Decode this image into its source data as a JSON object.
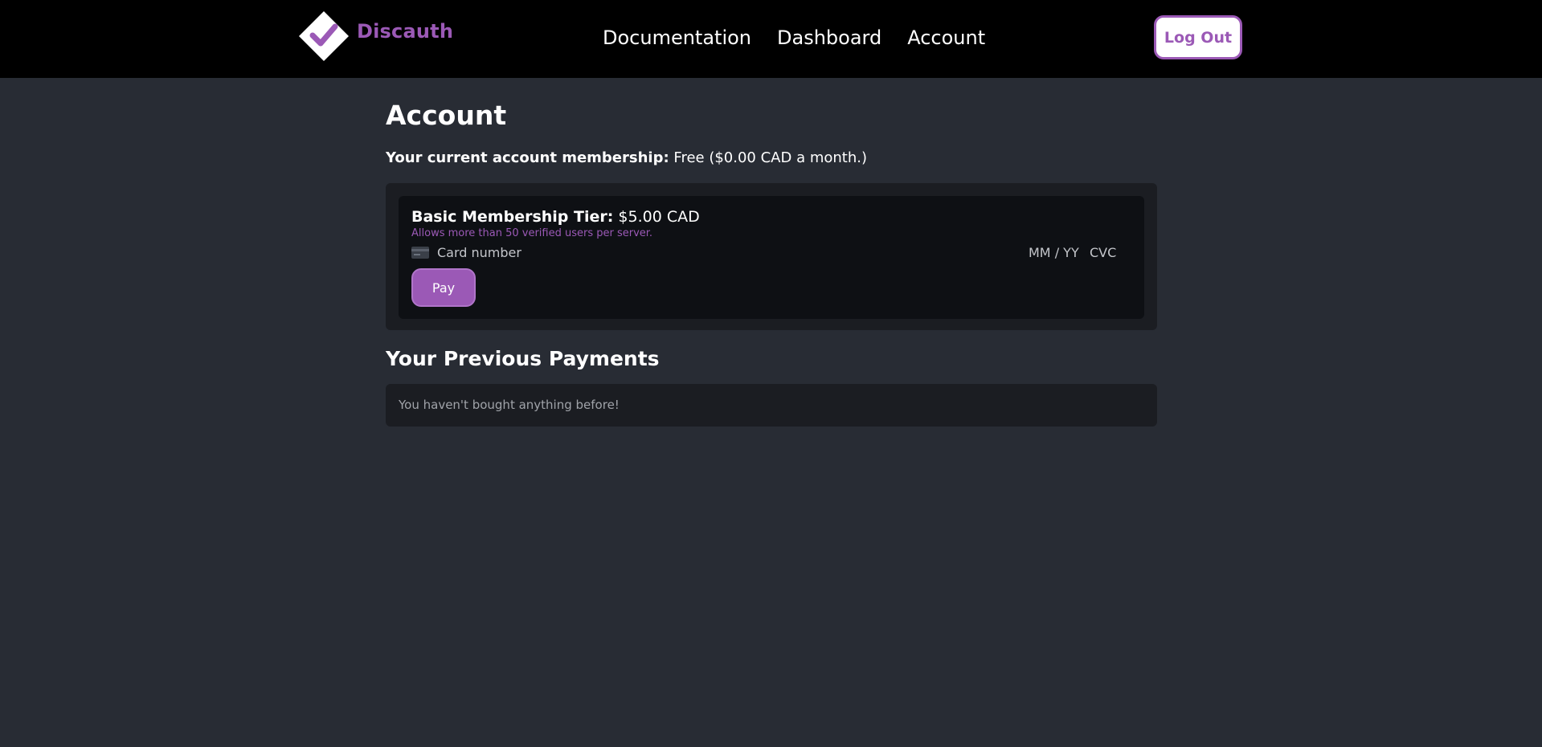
{
  "app": {
    "brand_name": "Discauth",
    "brand_color": "#9b59b6"
  },
  "nav": {
    "links": [
      {
        "label": "Documentation"
      },
      {
        "label": "Dashboard"
      },
      {
        "label": "Account"
      }
    ],
    "logout_label": "Log Out"
  },
  "page": {
    "title": "Account",
    "membership_label": "Your current account membership:",
    "membership_value": "Free ($0.00 CAD a month.)"
  },
  "tier": {
    "label": "Basic Membership Tier:",
    "price": "$5.00 CAD",
    "description": "Allows more than 50 verified users per server.",
    "card_icon": "credit-card-icon",
    "card_number_placeholder": "Card number",
    "card_expiry_placeholder": "MM / YY",
    "card_cvc_placeholder": "CVC",
    "pay_label": "Pay"
  },
  "payments": {
    "title": "Your Previous Payments",
    "empty_message": "You haven't bought anything before!"
  },
  "colors": {
    "page_background": "#282c34",
    "navbar_background": "#000000",
    "accent": "#9b59b6",
    "panel_background": "#1b1d22",
    "card_background": "#0e1014"
  }
}
